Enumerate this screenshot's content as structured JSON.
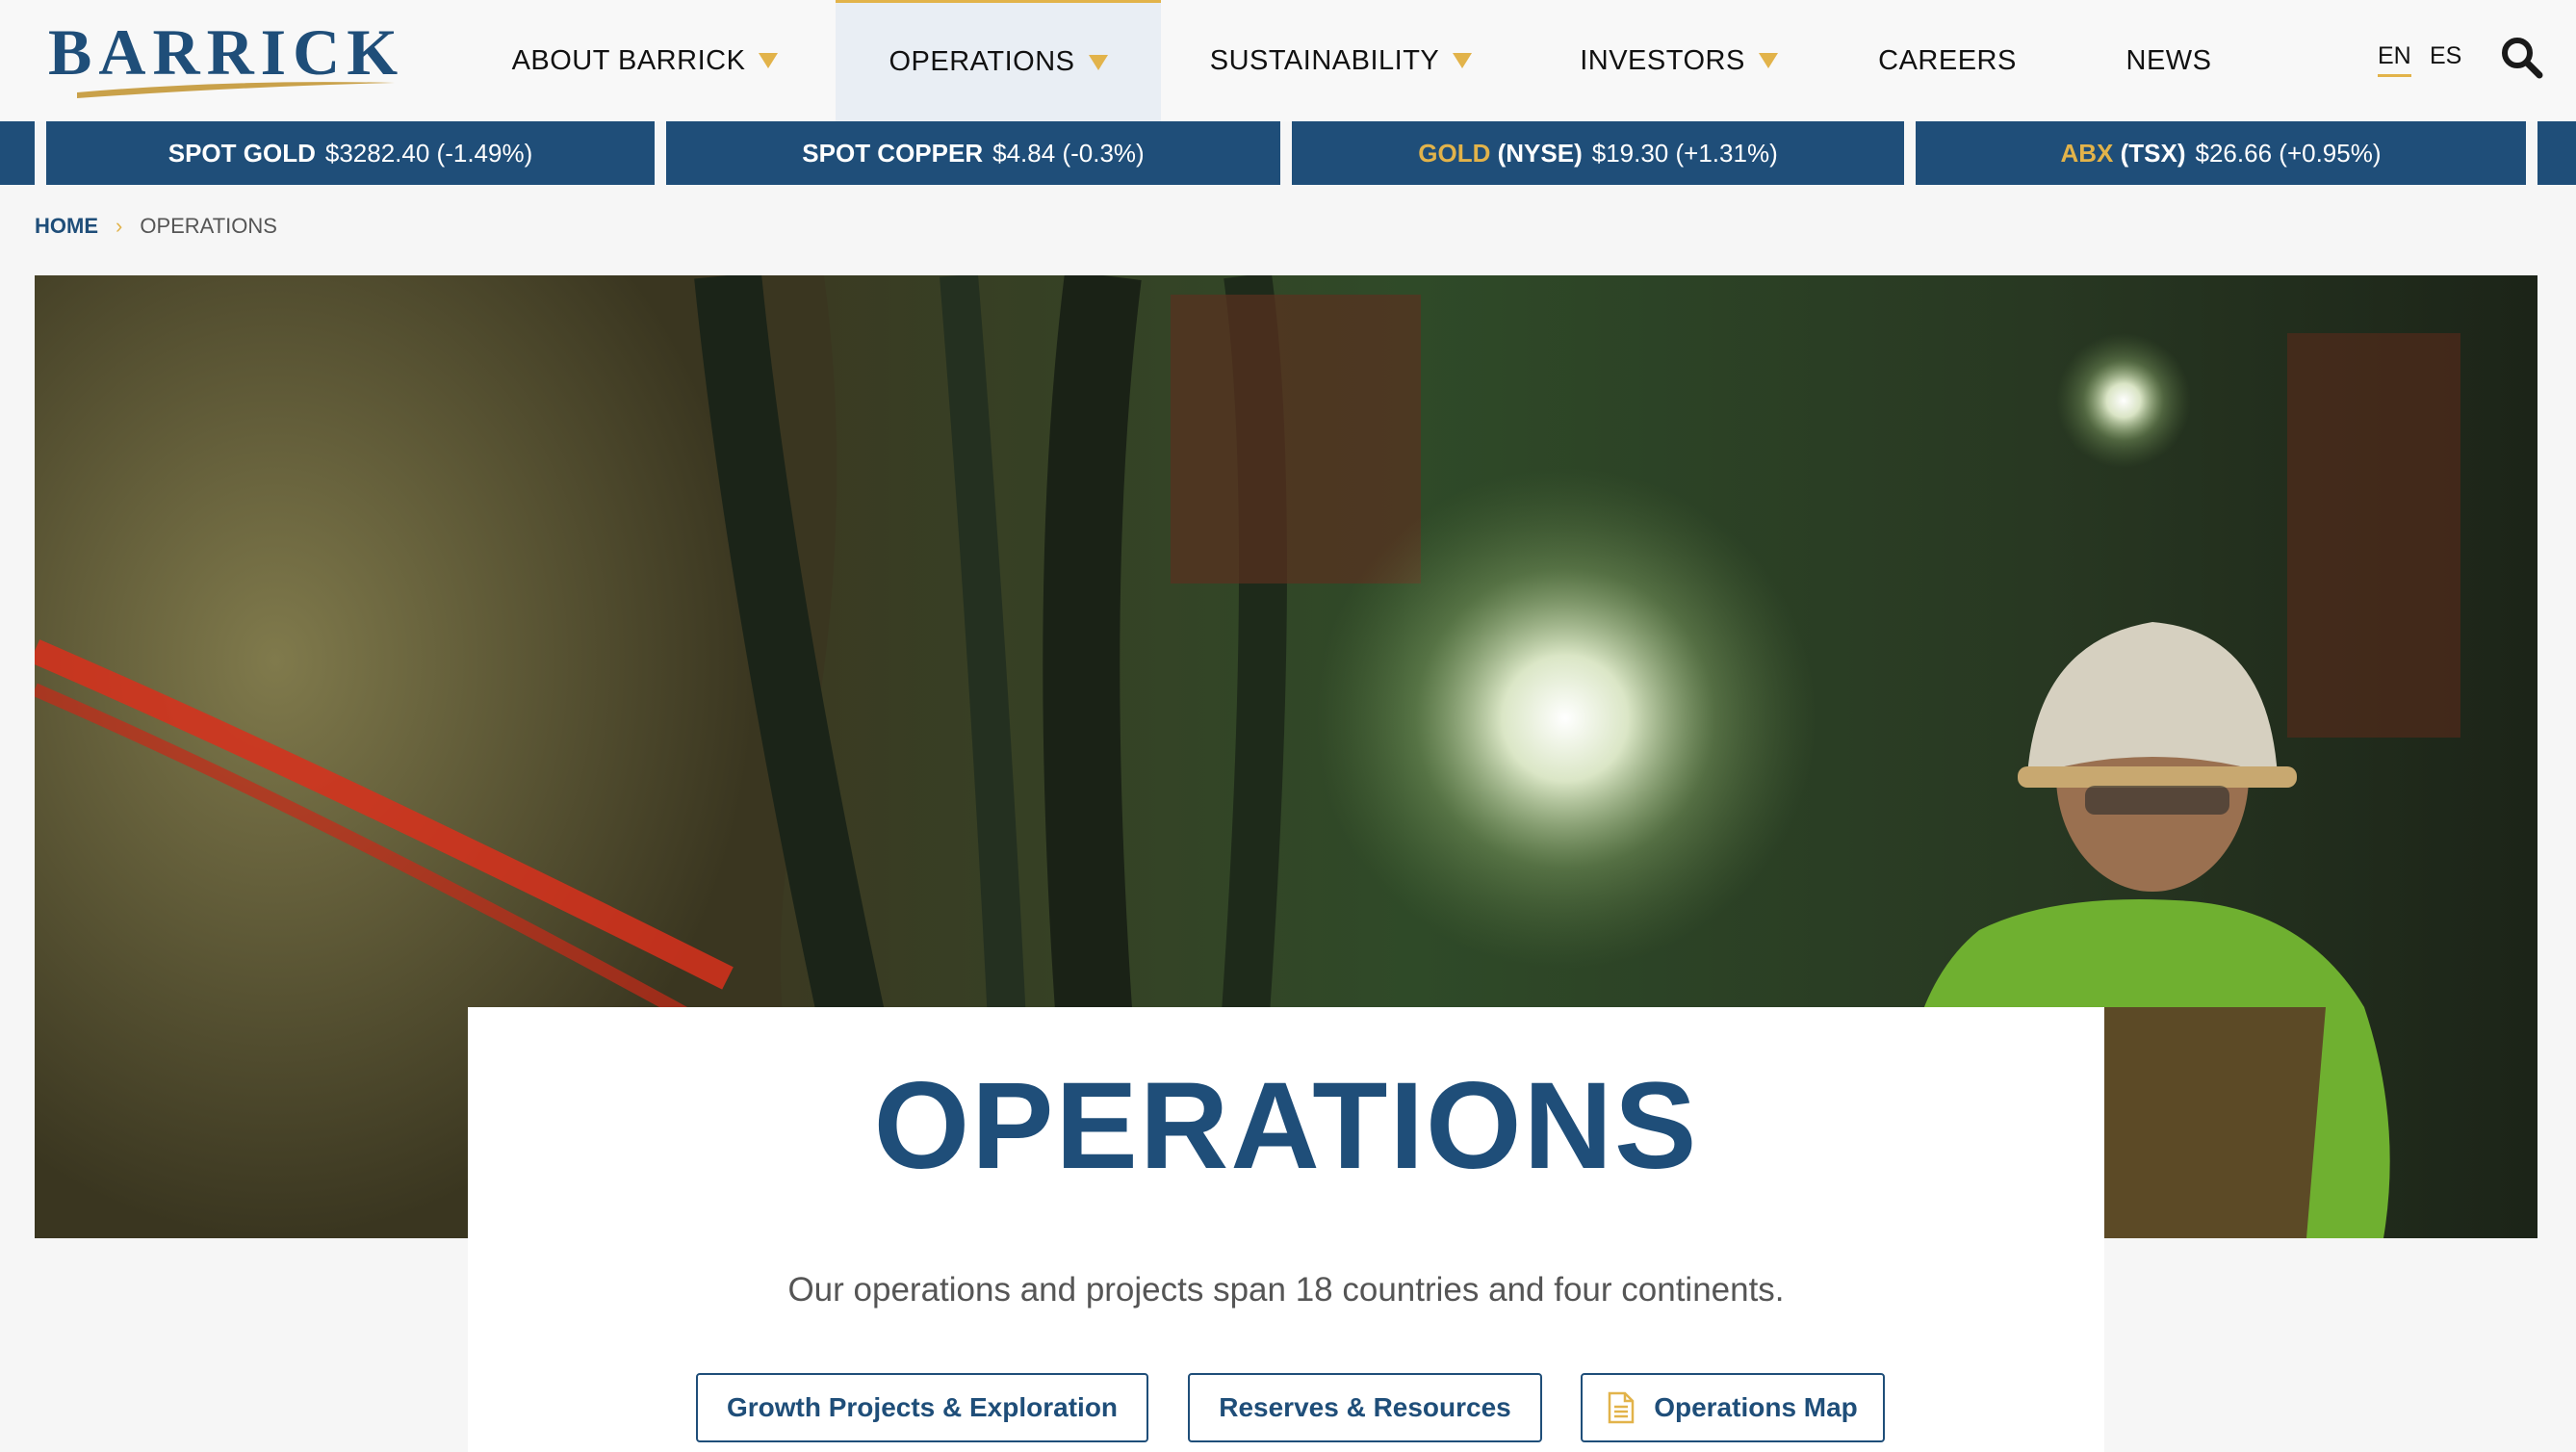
{
  "brand": {
    "name": "BARRICK"
  },
  "nav": {
    "items": [
      {
        "label": "ABOUT BARRICK",
        "dropdown": true
      },
      {
        "label": "OPERATIONS",
        "dropdown": true,
        "active": true
      },
      {
        "label": "SUSTAINABILITY",
        "dropdown": true
      },
      {
        "label": "INVESTORS",
        "dropdown": true
      },
      {
        "label": "CAREERS",
        "dropdown": false
      },
      {
        "label": "NEWS",
        "dropdown": false
      }
    ],
    "languages": [
      "EN",
      "ES"
    ],
    "active_language": "EN"
  },
  "ticker": [
    {
      "label": "SPOT GOLD",
      "value": "$3282.40",
      "change": "(-1.49%)"
    },
    {
      "label": "SPOT COPPER",
      "value": "$4.84",
      "change": "(-0.3%)"
    },
    {
      "label_gold": "GOLD",
      "label_rest": "(NYSE)",
      "value": "$19.30",
      "change": "(+1.31%)"
    },
    {
      "label_gold": "ABX",
      "label_rest": "(TSX)",
      "value": "$26.66",
      "change": "(+0.95%)"
    }
  ],
  "breadcrumb": {
    "home": "HOME",
    "current": "OPERATIONS"
  },
  "hero": {
    "title": "OPERATIONS",
    "subtitle": "Our operations and projects span 18 countries and four continents."
  },
  "buttons": {
    "growth": "Growth Projects & Exploration",
    "reserves": "Reserves & Resources",
    "map": "Operations Map"
  },
  "colors": {
    "brand_blue": "#1f4e79",
    "accent_gold": "#e2b34a",
    "background": "#f6f6f6"
  },
  "icons": {
    "search": "search-icon",
    "caret": "caret-down-icon",
    "document": "document-icon",
    "breadcrumb_separator": "chevron-right-icon"
  }
}
